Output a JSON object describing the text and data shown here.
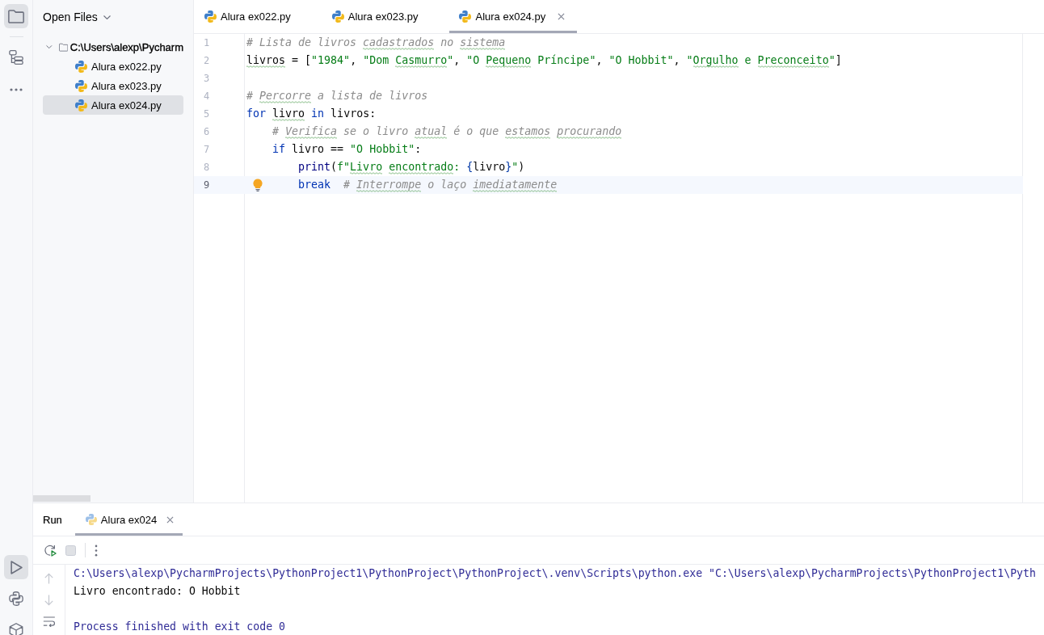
{
  "tool_strip": {
    "top": [
      {
        "kind": "folder",
        "selected": true
      },
      {
        "kind": "structure",
        "selected": false
      },
      {
        "kind": "more",
        "selected": false
      }
    ],
    "bottom": [
      {
        "kind": "run",
        "selected": true
      },
      {
        "kind": "console",
        "selected": false
      },
      {
        "kind": "services",
        "selected": false
      }
    ]
  },
  "project_panel": {
    "title": "Open Files",
    "tree": [
      {
        "kind": "folder",
        "label": "C:\\Users\\alexp\\Pycharm",
        "expanded": true,
        "selected": false,
        "children": [
          {
            "kind": "python",
            "label": "Alura ex022.py",
            "selected": false
          },
          {
            "kind": "python",
            "label": "Alura ex023.py",
            "selected": false
          },
          {
            "kind": "python",
            "label": "Alura ex024.py",
            "selected": true
          }
        ]
      }
    ]
  },
  "editor": {
    "tabs": [
      {
        "label": "Alura ex022.py",
        "selected": false
      },
      {
        "label": "Alura ex023.py",
        "selected": false
      },
      {
        "label": "Alura ex024.py",
        "selected": true
      }
    ],
    "lines": [
      {
        "number": "1",
        "current": false,
        "tokens": [
          {
            "kind": "comment",
            "text": "# Lista de livros "
          },
          {
            "kind": "comment",
            "text": "cadastrados",
            "typo": true
          },
          {
            "kind": "comment",
            "text": " no "
          },
          {
            "kind": "comment",
            "text": "sistema",
            "typo": true
          }
        ]
      },
      {
        "number": "2",
        "current": false,
        "tokens": [
          {
            "kind": "plain",
            "text": "livros",
            "typo": true
          },
          {
            "kind": "plain",
            "text": " = ["
          },
          {
            "kind": "string",
            "text": "\"1984\""
          },
          {
            "kind": "plain",
            "text": ", "
          },
          {
            "kind": "string",
            "text": "\"Dom "
          },
          {
            "kind": "string",
            "text": "Casmurro",
            "typo": true
          },
          {
            "kind": "string",
            "text": "\""
          },
          {
            "kind": "plain",
            "text": ", "
          },
          {
            "kind": "string",
            "text": "\"O "
          },
          {
            "kind": "string",
            "text": "Pequeno",
            "typo": true
          },
          {
            "kind": "string",
            "text": " Príncipe\""
          },
          {
            "kind": "plain",
            "text": ", "
          },
          {
            "kind": "string",
            "text": "\"O Hobbit\""
          },
          {
            "kind": "plain",
            "text": ", "
          },
          {
            "kind": "string",
            "text": "\""
          },
          {
            "kind": "string",
            "text": "Orgulho",
            "typo": true
          },
          {
            "kind": "string",
            "text": " e "
          },
          {
            "kind": "string",
            "text": "Preconceito",
            "typo": true
          },
          {
            "kind": "string",
            "text": "\""
          },
          {
            "kind": "plain",
            "text": "]"
          }
        ]
      },
      {
        "number": "3",
        "current": false
      },
      {
        "number": "4",
        "current": false,
        "tokens": [
          {
            "kind": "comment",
            "text": "# "
          },
          {
            "kind": "comment",
            "text": "Percorre",
            "typo": true
          },
          {
            "kind": "comment",
            "text": " a lista de livros"
          }
        ]
      },
      {
        "number": "5",
        "current": false,
        "tokens": [
          {
            "kind": "keyword",
            "text": "for"
          },
          {
            "kind": "plain",
            "text": " livro",
            "typo": true
          },
          {
            "kind": "keyword",
            "text": " in"
          },
          {
            "kind": "plain",
            "text": " livros:"
          }
        ]
      },
      {
        "number": "6",
        "current": false,
        "tokens": [
          {
            "kind": "comment",
            "text": "    # "
          },
          {
            "kind": "comment",
            "text": "Verifica",
            "typo": true
          },
          {
            "kind": "comment",
            "text": " se o livro "
          },
          {
            "kind": "comment",
            "text": "atual",
            "typo": true
          },
          {
            "kind": "comment",
            "text": " é o que "
          },
          {
            "kind": "comment",
            "text": "estamos",
            "typo": true
          },
          {
            "kind": "comment",
            "text": " procurando",
            "typo": true
          }
        ]
      },
      {
        "number": "7",
        "current": false,
        "tokens": [
          {
            "kind": "keyword",
            "text": "    if"
          },
          {
            "kind": "plain",
            "text": " livro == "
          },
          {
            "kind": "string",
            "text": "\"O Hobbit\""
          },
          {
            "kind": "plain",
            "text": ":"
          }
        ]
      },
      {
        "number": "8",
        "current": false,
        "tokens": [
          {
            "kind": "builtin",
            "text": "        print"
          },
          {
            "kind": "plain",
            "text": "("
          },
          {
            "kind": "string",
            "text": "f\""
          },
          {
            "kind": "string",
            "text": "Livro",
            "typo": true
          },
          {
            "kind": "string",
            "text": " encontrado",
            "typo": true
          },
          {
            "kind": "string",
            "text": ": "
          },
          {
            "kind": "brace",
            "text": "{"
          },
          {
            "kind": "plain",
            "text": "livro"
          },
          {
            "kind": "brace",
            "text": "}"
          },
          {
            "kind": "string",
            "text": "\""
          },
          {
            "kind": "plain",
            "text": ")"
          }
        ]
      },
      {
        "number": "9",
        "current": true,
        "bulb": true,
        "tokens": [
          {
            "kind": "keyword",
            "text": "        break"
          },
          {
            "kind": "comment",
            "text": "  # "
          },
          {
            "kind": "comment",
            "text": "Interrompe",
            "typo": true
          },
          {
            "kind": "comment",
            "text": " o laço "
          },
          {
            "kind": "comment",
            "text": "imediatamente",
            "typo": true
          }
        ]
      }
    ]
  },
  "run_panel": {
    "title": "Run",
    "tabs": [
      {
        "label": "Alura ex024",
        "selected": true
      }
    ],
    "toolbar": [
      {
        "kind": "rerun",
        "disabled": false
      },
      {
        "kind": "stop",
        "disabled": true
      },
      {
        "kind": "more",
        "disabled": false
      }
    ],
    "side_tools": [
      {
        "kind": "up",
        "disabled": true
      },
      {
        "kind": "down",
        "disabled": true
      },
      {
        "kind": "wrap",
        "disabled": false
      }
    ],
    "output": [
      {
        "kind": "system",
        "text": "C:\\Users\\alexp\\PycharmProjects\\PythonProject1\\PythonProject\\PythonProject\\.venv\\Scripts\\python.exe \"C:\\Users\\alexp\\PycharmProjects\\PythonProject1\\Pyth"
      },
      {
        "kind": "stdout",
        "text": "Livro encontrado: O Hobbit"
      },
      {
        "kind": "blank"
      },
      {
        "kind": "system",
        "text": "Process finished with exit code 0"
      }
    ]
  }
}
